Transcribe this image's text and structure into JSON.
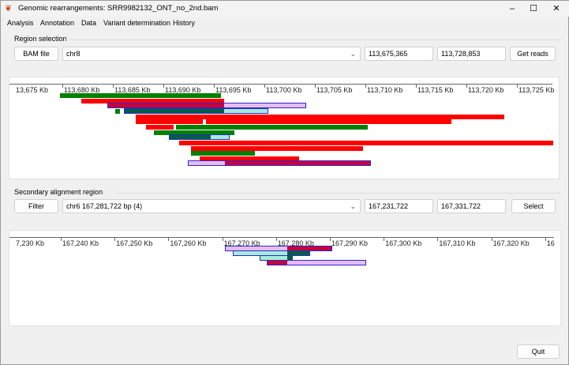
{
  "window": {
    "title": "Genomic rearrangements: SRR9982132_ONT_no_2nd.bam",
    "minimize": "–",
    "maximize": "☐",
    "close": "✕"
  },
  "menu": [
    "Analysis",
    "Annotation",
    "Data",
    "Variant determination",
    "History"
  ],
  "region": {
    "label": "Region selection",
    "bam_button": "BAM file",
    "chromosome": "chr8",
    "start": "113,675,365",
    "end": "113,728,853",
    "get_reads_button": "Get reads"
  },
  "secondary": {
    "label": "Secondary alignment region",
    "filter_button": "Filter",
    "region": "chr6 167,281,722 bp (4)",
    "start": "167,231,722",
    "end": "167,331,722",
    "select_button": "Select"
  },
  "quit_button": "Quit",
  "colors": {
    "forward": "#008000",
    "reverse": "#ff0000",
    "supp_reverse": "#c8003c",
    "supp_reverse_other": "#e8bcf2",
    "supp_forward": "#00603c",
    "supp_forward_other": "#a6ecd6",
    "outline": "#2a2ad0"
  },
  "chart_data": [
    {
      "type": "track",
      "name": "primary",
      "ticks": [
        "13,675 Kb",
        "113,680 Kb",
        "113,685 Kb",
        "113,690 Kb",
        "113,695 Kb",
        "113,700 Kb",
        "113,705 Kb",
        "113,710 Kb",
        "113,715 Kb",
        "113,720 Kb",
        "113,725 Kb"
      ],
      "tick_kb": [
        113675,
        113680,
        113685,
        113690,
        113695,
        113700,
        113705,
        113710,
        113715,
        113720,
        113725
      ],
      "reads": [
        {
          "row": 0,
          "segments": [
            {
              "s": 113679.8,
              "e": 113695.7,
              "c": "forward"
            }
          ]
        },
        {
          "row": 1,
          "segments": [
            {
              "s": 113681.9,
              "e": 113696.0,
              "c": "reverse"
            }
          ]
        },
        {
          "row": 2,
          "outline": [
            113684.5,
            113704.1
          ],
          "segments": [
            {
              "s": 113684.5,
              "e": 113696.0,
              "c": "supp_reverse"
            },
            {
              "s": 113696.0,
              "e": 113704.1,
              "c": "supp_reverse_other"
            }
          ]
        },
        {
          "row": 3,
          "segments": [
            {
              "s": 113685.2,
              "e": 113685.7,
              "c": "forward"
            }
          ]
        },
        {
          "row": 3,
          "outline": [
            113686.2,
            113700.3
          ],
          "segments": [
            {
              "s": 113686.2,
              "e": 113696.0,
              "c": "supp_forward"
            },
            {
              "s": 113696.0,
              "e": 113700.3,
              "c": "supp_forward_other"
            }
          ]
        },
        {
          "row": 4,
          "segments": [
            {
              "s": 113687.3,
              "e": 113723.75,
              "c": "reverse"
            }
          ]
        },
        {
          "row": 5,
          "segments": [
            {
              "s": 113687.3,
              "e": 113693.9,
              "c": "reverse"
            },
            {
              "s": 113694.2,
              "e": 113718.5,
              "c": "reverse"
            }
          ]
        },
        {
          "row": 6,
          "segments": [
            {
              "s": 113688.3,
              "e": 113691.0,
              "c": "reverse"
            },
            {
              "s": 113691.25,
              "e": 113710.2,
              "c": "forward"
            }
          ]
        },
        {
          "row": 7,
          "segments": [
            {
              "s": 113689.1,
              "e": 113697.0,
              "c": "forward"
            }
          ]
        },
        {
          "row": 8,
          "outline": [
            113690.6,
            113696.5
          ],
          "segments": [
            {
              "s": 113690.6,
              "e": 113694.7,
              "c": "supp_forward"
            },
            {
              "s": 113694.7,
              "e": 113696.5,
              "c": "supp_forward_other"
            }
          ]
        },
        {
          "row": 9,
          "segments": [
            {
              "s": 113691.6,
              "e": 113728.6,
              "c": "reverse"
            }
          ]
        },
        {
          "row": 10,
          "segments": [
            {
              "s": 113692.7,
              "e": 113709.8,
              "c": "reverse"
            }
          ]
        },
        {
          "row": 11,
          "segments": [
            {
              "s": 113692.7,
              "e": 113699.1,
              "c": "forward"
            }
          ]
        },
        {
          "row": 12,
          "segments": [
            {
              "s": 113693.6,
              "e": 113703.4,
              "c": "reverse"
            }
          ]
        },
        {
          "row": 13,
          "outline": [
            113692.5,
            113710.5
          ],
          "segments": [
            {
              "s": 113692.5,
              "e": 113696.1,
              "c": "supp_reverse_other"
            },
            {
              "s": 113696.1,
              "e": 113710.5,
              "c": "supp_reverse"
            }
          ]
        }
      ]
    },
    {
      "type": "track",
      "name": "secondary",
      "ticks": [
        "7,230 Kb",
        "167,240 Kb",
        "167,250 Kb",
        "167,260 Kb",
        "167,270 Kb",
        "167,280 Kb",
        "167,290 Kb",
        "167,300 Kb",
        "167,310 Kb",
        "167,320 Kb",
        "16"
      ],
      "tick_kb": [
        167230,
        167240,
        167250,
        167260,
        167270,
        167280,
        167290,
        167300,
        167310,
        167320,
        167330
      ],
      "reads": [
        {
          "row": 0,
          "outline": [
            167270.7,
            167290.3
          ],
          "segments": [
            {
              "s": 167270.7,
              "e": 167282.1,
              "c": "supp_reverse_other"
            },
            {
              "s": 167282.1,
              "e": 167290.3,
              "c": "supp_reverse"
            }
          ]
        },
        {
          "row": 1,
          "outline": [
            167272.1,
            167286.2
          ],
          "segments": [
            {
              "s": 167272.1,
              "e": 167282.1,
              "c": "supp_forward_other"
            },
            {
              "s": 167282.1,
              "e": 167286.2,
              "c": "supp_forward"
            }
          ]
        },
        {
          "row": 2,
          "outline": [
            167277.1,
            167282.9
          ],
          "segments": [
            {
              "s": 167277.1,
              "e": 167282.1,
              "c": "supp_forward_other"
            },
            {
              "s": 167282.1,
              "e": 167282.9,
              "c": "supp_forward"
            }
          ]
        },
        {
          "row": 3,
          "outline": [
            167278.4,
            167296.6
          ],
          "segments": [
            {
              "s": 167278.4,
              "e": 167282.1,
              "c": "supp_reverse"
            },
            {
              "s": 167282.1,
              "e": 167296.6,
              "c": "supp_reverse_other"
            }
          ]
        }
      ]
    }
  ]
}
